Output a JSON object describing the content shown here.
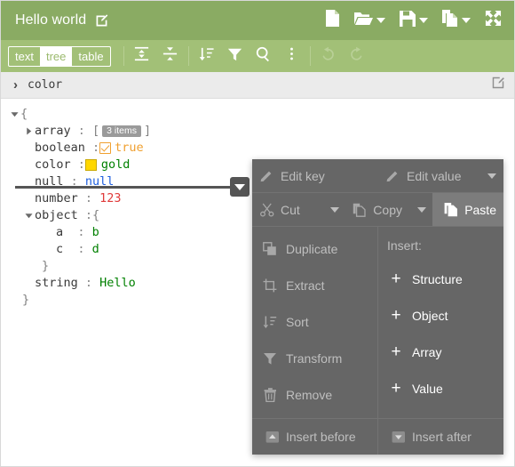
{
  "header": {
    "title": "Hello world",
    "edit_icon": "edit-pencil-icon",
    "actions": [
      {
        "name": "new-document",
        "icon": "file-icon",
        "has_caret": false
      },
      {
        "name": "open-file",
        "icon": "folder-open-icon",
        "has_caret": true
      },
      {
        "name": "save-file",
        "icon": "save-disk-icon",
        "has_caret": true
      },
      {
        "name": "copy-document",
        "icon": "copy-icon",
        "has_caret": true
      },
      {
        "name": "fullscreen",
        "icon": "expand-arrows-icon",
        "has_caret": false
      }
    ]
  },
  "toolbar": {
    "modes": [
      {
        "label": "text",
        "active": false
      },
      {
        "label": "tree",
        "active": true
      },
      {
        "label": "table",
        "active": false
      }
    ],
    "buttons": [
      {
        "name": "expand-all",
        "icon": "expand-all-icon",
        "disabled": false
      },
      {
        "name": "collapse-all",
        "icon": "collapse-all-icon",
        "disabled": false
      },
      {
        "name": "sort",
        "icon": "sort-icon",
        "disabled": false
      },
      {
        "name": "filter",
        "icon": "filter-funnel-icon",
        "disabled": false
      },
      {
        "name": "search",
        "icon": "search-magnifier-icon",
        "disabled": false
      },
      {
        "name": "more-options",
        "icon": "vertical-dots-icon",
        "disabled": false
      },
      {
        "name": "undo",
        "icon": "undo-arrow-icon",
        "disabled": true
      },
      {
        "name": "redo",
        "icon": "redo-arrow-icon",
        "disabled": true
      }
    ]
  },
  "breadcrumb": {
    "chevron": "›",
    "path": "color",
    "edit_icon": "edit-square-icon"
  },
  "tree": {
    "root_open_brace": "{",
    "root_close_brace": "}",
    "rows": [
      {
        "key": "array",
        "colon": ":",
        "value": "",
        "type": "array",
        "open": "[",
        "close": "]",
        "badge": "3 items",
        "expanded": false
      },
      {
        "key": "boolean",
        "colon": ":",
        "value": "true",
        "type": "boolean"
      },
      {
        "key": "color",
        "colon": ":",
        "value": "gold",
        "type": "color",
        "swatch": "#ffd700"
      },
      {
        "key": "null",
        "colon": ":",
        "value": "null",
        "type": "null"
      },
      {
        "key": "number",
        "colon": ":",
        "value": "123",
        "type": "number"
      },
      {
        "key": "object",
        "colon": ":",
        "value": "",
        "type": "object",
        "open": "{",
        "close": "}",
        "expanded": true
      },
      {
        "key": "a",
        "colon": ":",
        "value": "b",
        "type": "string",
        "child": true
      },
      {
        "key": "c",
        "colon": ":",
        "value": "d",
        "type": "string",
        "child": true
      },
      {
        "key": "string",
        "colon": ":",
        "value": "Hello",
        "type": "string"
      }
    ]
  },
  "insert_marker": {
    "button_icon": "chevron-down-icon"
  },
  "context_menu": {
    "edit_key": {
      "label": "Edit key",
      "icon": "pencil-icon",
      "disabled": true
    },
    "edit_value": {
      "label": "Edit value",
      "icon": "pencil-icon",
      "disabled": true
    },
    "cut": {
      "label": "Cut",
      "icon": "scissors-icon",
      "disabled": true
    },
    "copy": {
      "label": "Copy",
      "icon": "copy-icon",
      "disabled": true
    },
    "paste": {
      "label": "Paste",
      "icon": "paste-icon",
      "highlighted": true
    },
    "left_items": [
      {
        "label": "Duplicate",
        "icon": "duplicate-icon",
        "disabled": true
      },
      {
        "label": "Extract",
        "icon": "extract-icon",
        "disabled": true
      },
      {
        "label": "Sort",
        "icon": "sort-icon",
        "disabled": true
      },
      {
        "label": "Transform",
        "icon": "filter-funnel-icon",
        "disabled": true
      },
      {
        "label": "Remove",
        "icon": "trash-icon",
        "disabled": true
      }
    ],
    "insert_label": "Insert:",
    "insert_items": [
      {
        "label": "Structure",
        "icon": "plus-icon"
      },
      {
        "label": "Object",
        "icon": "plus-icon"
      },
      {
        "label": "Array",
        "icon": "plus-icon"
      },
      {
        "label": "Value",
        "icon": "plus-icon"
      }
    ],
    "insert_before": {
      "label": "Insert before",
      "icon": "arrow-up-box-icon",
      "disabled": true
    },
    "insert_after": {
      "label": "Insert after",
      "icon": "arrow-down-box-icon",
      "disabled": true
    }
  },
  "colors": {
    "header_green": "#8aab63",
    "toolbar_green": "#a2c077",
    "menu_gray": "#666666",
    "menu_highlight": "#7c7c7c",
    "string_green": "#008000",
    "number_red": "#e03a3a",
    "null_blue": "#2060df",
    "bool_orange": "#f0a030"
  }
}
